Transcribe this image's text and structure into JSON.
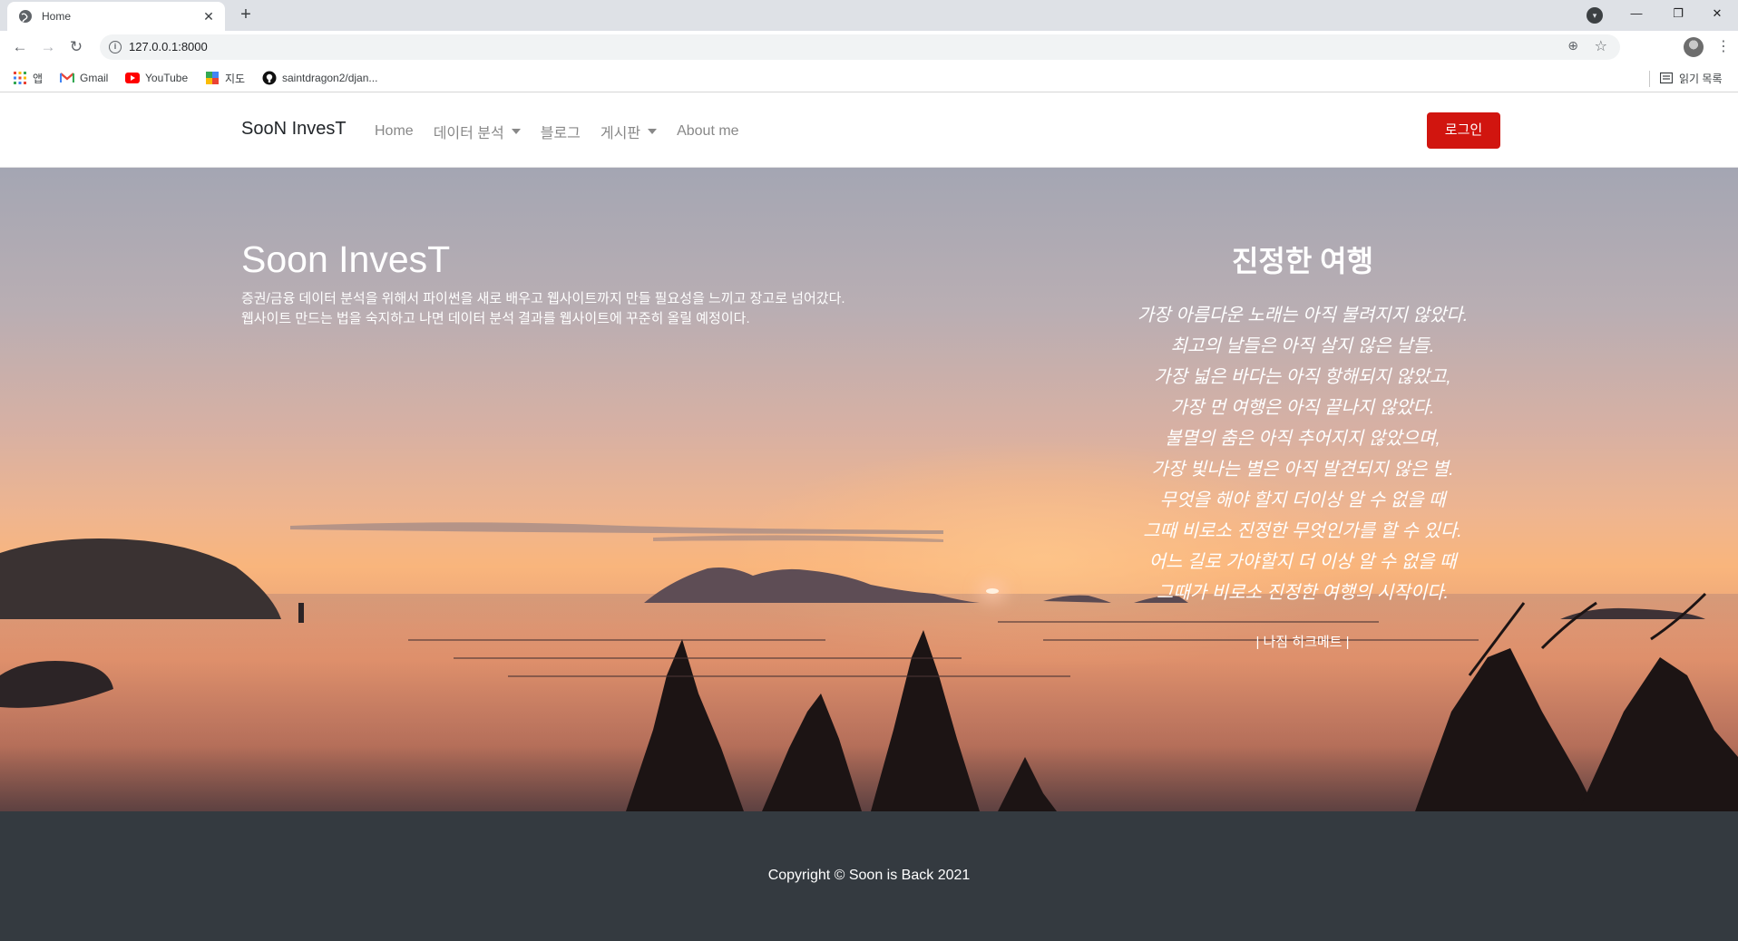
{
  "browser": {
    "tab_title": "Home",
    "tab_close": "✕",
    "new_tab": "+",
    "url": "127.0.0.1:8000",
    "window_controls": [
      "—",
      "❐",
      "✕"
    ],
    "bookmarks": [
      "앱",
      "Gmail",
      "YouTube",
      "지도",
      "saintdragon2/djan..."
    ],
    "reading_list": "읽기 목록"
  },
  "nav": {
    "brand": "SooN InvesT",
    "links": [
      "Home",
      "데이터 분석",
      "블로그",
      "게시판",
      "About me"
    ],
    "login": "로그인"
  },
  "hero": {
    "title": "Soon InvesT",
    "description": "증권/금융 데이터 분석을 위해서 파이썬을 새로 배우고 웹사이트까지 만들 필요성을 느끼고 장고로 넘어갔다. 웹사이트 만드는 법을 숙지하고 나면 데이터 분석 결과를 웹사이트에 꾸준히 올릴 예정이다.",
    "poem_title": "진정한 여행",
    "poem_lines": [
      "가장 아름다운 노래는 아직 불려지지 않았다.",
      "최고의 날들은 아직 살지 않은 날들.",
      "가장 넓은 바다는 아직 항해되지 않았고,",
      "가장 먼 여행은 아직 끝나지 않았다.",
      "불멸의 춤은 아직 추어지지 않았으며,",
      "가장 빛나는 별은 아직 발견되지 않은 별.",
      "무엇을 해야 할지 더이상 알 수 없을 때",
      "그때 비로소 진정한 무엇인가를 할 수 있다.",
      "어느 길로 가야할지 더 이상 알 수 없을 때",
      "그때가 비로소 진정한 여행의 시작이다."
    ],
    "poem_author": "| 나짐 히크메트 |"
  },
  "footer": {
    "copyright": "Copyright © Soon is Back 2021"
  }
}
